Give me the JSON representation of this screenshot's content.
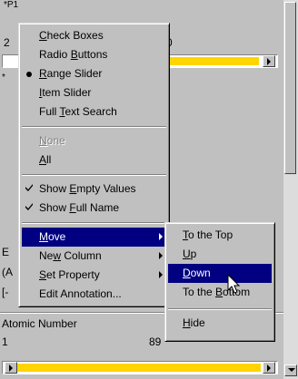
{
  "panel_top": {
    "title": "*P1",
    "value_left": "2",
    "value_right": "0",
    "slider_fill": 0.7,
    "marker": "*"
  },
  "panel_mid": {
    "e_label": "E",
    "paren": "(A",
    "box": "[-"
  },
  "panel_bottom": {
    "title": "Atomic Number",
    "value_min": "1",
    "value_max": "89",
    "slider_fill": 1.0
  },
  "context_menu": {
    "items": [
      {
        "label": "Check Boxes",
        "mnemonic": "C"
      },
      {
        "label": "Radio Buttons",
        "mnemonic": "B"
      },
      {
        "label": "Range Slider",
        "mnemonic": "R",
        "bullet": true
      },
      {
        "label": "Item Slider",
        "mnemonic": "I"
      },
      {
        "label": "Full Text Search",
        "mnemonic": "T"
      },
      {
        "label": "None",
        "mnemonic": "N",
        "disabled": true
      },
      {
        "label": "All",
        "mnemonic": "A"
      },
      {
        "label": "Show Empty Values",
        "mnemonic": "E",
        "checked": true
      },
      {
        "label": "Show Full Name",
        "mnemonic": "F",
        "checked": true
      },
      {
        "label": "Move",
        "mnemonic": "M",
        "submenu": true,
        "highlighted": true
      },
      {
        "label": "New Column",
        "mnemonic": "w",
        "submenu": true
      },
      {
        "label": "Set Property",
        "mnemonic": "S",
        "submenu": true
      },
      {
        "label": "Edit Annotation...",
        "mnemonic": ""
      }
    ]
  },
  "move_submenu": {
    "items": [
      {
        "label": "To the Top",
        "mnemonic": "T"
      },
      {
        "label": "Up",
        "mnemonic": "U"
      },
      {
        "label": "Down",
        "mnemonic": "D",
        "highlighted": true
      },
      {
        "label": "To the Bottom",
        "mnemonic": "B"
      },
      {
        "label": "Hide",
        "mnemonic": "H"
      }
    ]
  },
  "icons": {
    "check": "check-mark-icon",
    "bullet": "radio-bullet-icon",
    "submenu": "submenu-arrow-icon",
    "cursor": "mouse-pointer-icon"
  },
  "colors": {
    "face": "#c0c0c0",
    "highlight": "#000080",
    "slider_fill": "#ffd400"
  }
}
